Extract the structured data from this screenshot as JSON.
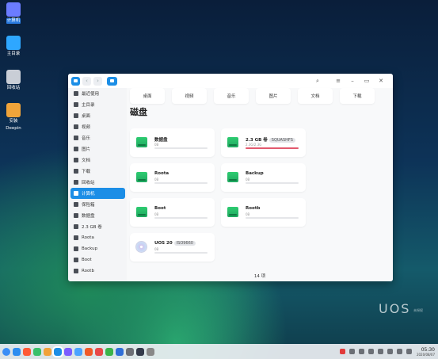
{
  "desktop": {
    "icons": [
      {
        "label": "计算机",
        "color": "#6b7cff",
        "selected": true
      },
      {
        "label": "主目录",
        "color": "#2ea7ff"
      },
      {
        "label": "回收站",
        "color": "#c9ced6"
      },
      {
        "label": "安装\nDeepin",
        "label_line1": "安装",
        "label_line2": "Deepin",
        "color": "#f0a43a"
      }
    ],
    "watermark": "UOS",
    "watermark_sub": "未授权"
  },
  "window": {
    "sidebar": {
      "items": [
        {
          "label": "最近使用",
          "icon": "clock-icon"
        },
        {
          "label": "主目录",
          "icon": "home-icon"
        },
        {
          "label": "桌面",
          "icon": "desktop-icon"
        },
        {
          "label": "视频",
          "icon": "video-icon"
        },
        {
          "label": "音乐",
          "icon": "music-icon"
        },
        {
          "label": "图片",
          "icon": "picture-icon"
        },
        {
          "label": "文档",
          "icon": "document-icon"
        },
        {
          "label": "下载",
          "icon": "download-icon"
        },
        {
          "label": "回收站",
          "icon": "trash-icon"
        },
        {
          "label": "计算机",
          "icon": "computer-icon",
          "active": true
        },
        {
          "label": "保险箱",
          "icon": "vault-icon"
        },
        {
          "label": "数据盘",
          "icon": "disk-icon"
        },
        {
          "label": "2.3 GB 卷",
          "icon": "disk-icon"
        },
        {
          "label": "Roota",
          "icon": "disk-icon"
        },
        {
          "label": "Backup",
          "icon": "disk-icon"
        },
        {
          "label": "Boot",
          "icon": "disk-icon"
        },
        {
          "label": "Rootb",
          "icon": "disk-icon"
        }
      ]
    },
    "folders": [
      "桌面",
      "视频",
      "音乐",
      "图片",
      "文档",
      "下载"
    ],
    "section_title": "磁盘",
    "disks": [
      {
        "name": "数据盘",
        "tag": "",
        "size": "0B",
        "usage": 0,
        "type": "disk"
      },
      {
        "name": "2.3 GB 卷",
        "tag": "SQUASHFS",
        "size": "2.3G/2.3G",
        "usage": 1.0,
        "type": "disk"
      },
      {
        "name": "Roota",
        "tag": "",
        "size": "0B",
        "usage": 0,
        "type": "disk"
      },
      {
        "name": "Backup",
        "tag": "",
        "size": "0B",
        "usage": 0,
        "type": "disk"
      },
      {
        "name": "Boot",
        "tag": "",
        "size": "0B",
        "usage": 0,
        "type": "disk"
      },
      {
        "name": "Rootb",
        "tag": "",
        "size": "0B",
        "usage": 0,
        "type": "disk"
      },
      {
        "name": "UOS 20",
        "tag": "ISO9660",
        "size": "0B",
        "usage": 0,
        "type": "cdrom"
      }
    ],
    "status": "14 项"
  },
  "taskbar": {
    "apps": [
      "#2c8df0",
      "#ff5a36",
      "#39c06a",
      "#f1a23a",
      "#1c8ee6",
      "#7b5cff",
      "#4aa3ff",
      "#f05a28",
      "#e84848",
      "#3ab34a",
      "#2f6fd8",
      "#6c6f76",
      "#333a4a",
      "#888"
    ],
    "time": "05:30",
    "date": "2020/08/07"
  }
}
